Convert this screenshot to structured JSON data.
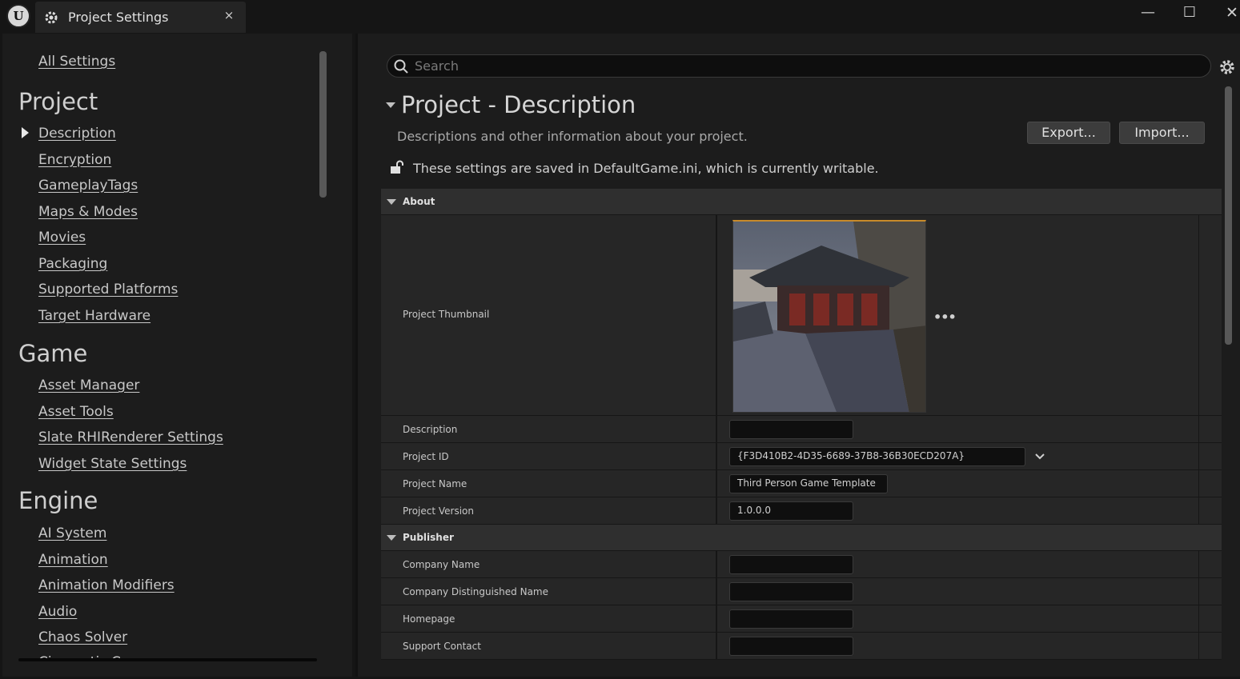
{
  "titlebar": {
    "tab_title": "Project Settings",
    "close_symbol": "×",
    "minimize_symbol": "—",
    "maximize_symbol": "☐",
    "window_close_symbol": "✕",
    "logo_letter": "U"
  },
  "sidebar": {
    "all_settings": "All Settings",
    "sections": [
      {
        "heading": "Project",
        "items": [
          "Description",
          "Encryption",
          "GameplayTags",
          "Maps & Modes",
          "Movies",
          "Packaging",
          "Supported Platforms",
          "Target Hardware"
        ]
      },
      {
        "heading": "Game",
        "items": [
          "Asset Manager",
          "Asset Tools",
          "Slate RHIRenderer Settings",
          "Widget State Settings"
        ]
      },
      {
        "heading": "Engine",
        "items": [
          "AI System",
          "Animation",
          "Animation Modifiers",
          "Audio",
          "Chaos Solver",
          "Cinematic Camera"
        ]
      }
    ],
    "selected_item": "Description"
  },
  "main": {
    "search": {
      "placeholder": "Search",
      "value": ""
    },
    "title": "Project - Description",
    "description": "Descriptions and other information about your project.",
    "export_label": "Export...",
    "import_label": "Import...",
    "writable_notice": "These settings are saved in DefaultGame.ini, which is currently writable.",
    "categories": [
      {
        "name": "About",
        "properties": [
          {
            "label": "Project Thumbnail",
            "value": ""
          },
          {
            "label": "Description",
            "value": ""
          },
          {
            "label": "Project ID",
            "value": "{F3D410B2-4D35-6689-37B8-36B30ECD207A}"
          },
          {
            "label": "Project Name",
            "value": "Third Person Game Template"
          },
          {
            "label": "Project Version",
            "value": "1.0.0.0"
          }
        ]
      },
      {
        "name": "Publisher",
        "properties": [
          {
            "label": "Company Name",
            "value": ""
          },
          {
            "label": "Company Distinguished Name",
            "value": ""
          },
          {
            "label": "Homepage",
            "value": ""
          },
          {
            "label": "Support Contact",
            "value": ""
          }
        ]
      }
    ],
    "thumbnail_menu": "•••"
  },
  "colors": {
    "background": "#1c1c1c",
    "category_row": "#2f2f2f",
    "property_row": "#262626",
    "input_bg": "#0f0f0f",
    "thumbnail_highlight": "#c88a2a"
  },
  "icons": [
    "unreal-logo-icon",
    "settings-cog-icon",
    "search-icon",
    "gear-icon",
    "lock-open-icon",
    "chevron-down-icon"
  ]
}
